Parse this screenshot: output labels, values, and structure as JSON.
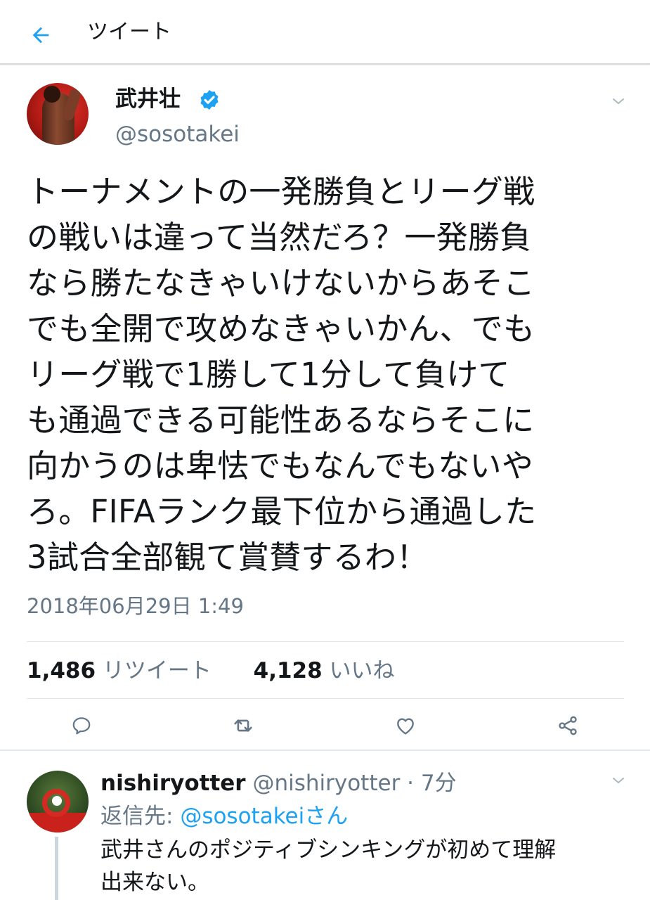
{
  "header": {
    "title": "ツイート",
    "back_icon": "arrow-left-icon",
    "accent": "#1da1f2"
  },
  "tweet": {
    "author_name": "武井壮",
    "verified_icon": "verified-badge-icon",
    "handle": "@sosotakei",
    "text": "トーナメントの一発勝負とリーグ戦\nの戦いは違って当然だろ？一発勝負\nなら勝たなきゃいけないからあそこ\nでも全開で攻めなきゃいかん、でも\nリーグ戦で1勝して1分して負けて\nも通過できる可能性あるならそこに\n向かうのは卑怯でもなんでもないや\nろ。FIFAランク最下位から通過した\n3試合全部観て賞賛するわ！",
    "timestamp": "2018年06月29日 1:49",
    "retweet_count": "1,486",
    "retweet_label": "リツイート",
    "like_count": "4,128",
    "like_label": "いいね"
  },
  "actions": {
    "reply_icon": "reply-icon",
    "retweet_icon": "retweet-icon",
    "like_icon": "heart-icon",
    "share_icon": "share-icon"
  },
  "reply": {
    "author_name": "nishiryotter",
    "handle_meta": "@nishiryotter · 7分",
    "reply_to_prefix": "返信先: ",
    "reply_to_mention": "@sosotakeiさん",
    "text": "武井さんのポジティブシンキングが初めて理解\n出来ない。"
  },
  "colors": {
    "text_primary": "#14171a",
    "text_secondary": "#657786",
    "link": "#1da1f2",
    "divider": "#e1e8ed"
  }
}
